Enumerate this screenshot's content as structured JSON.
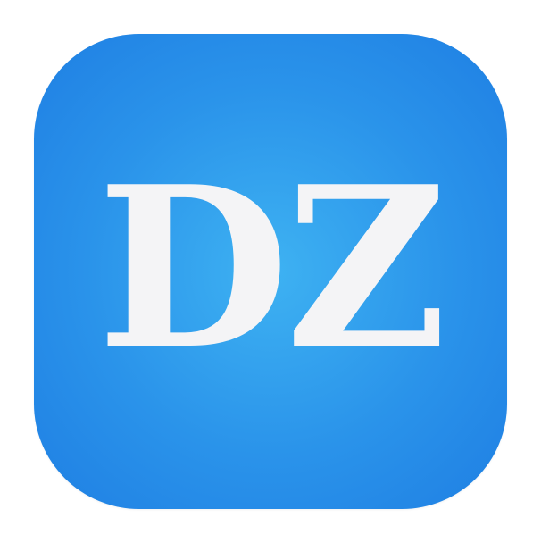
{
  "icon": {
    "text": "DZ",
    "background_color": "#2a93ea",
    "highlight_color": "#3eb2f2",
    "text_color": "#f4f4f6"
  }
}
